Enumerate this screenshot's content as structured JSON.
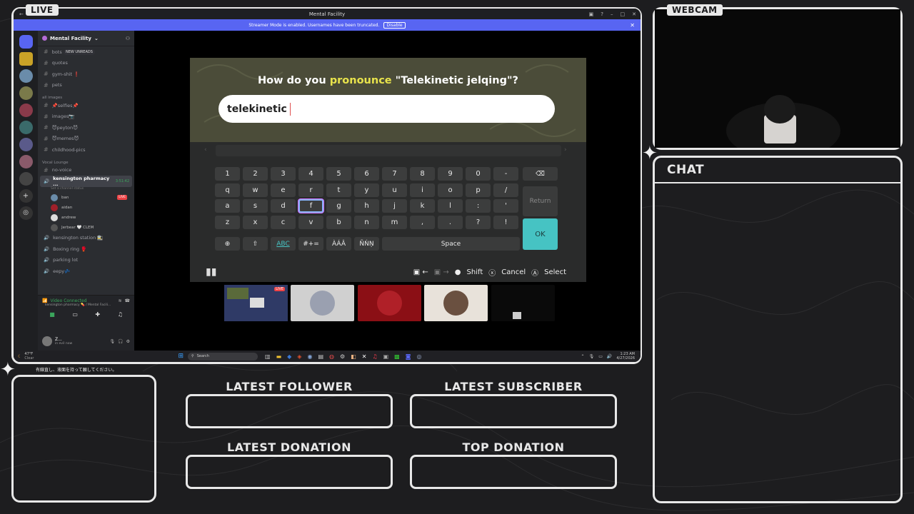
{
  "overlay": {
    "live_tag": "LIVE",
    "webcam_tag": "WEBCAM",
    "chat_title": "CHAT",
    "japanese_note": "有線直し、液面を持って願してください。",
    "latest_follower": "LATEST FOLLOWER",
    "latest_subscriber": "LATEST SUBSCRIBER",
    "latest_donation": "LATEST DONATION",
    "top_donation": "TOP DONATION"
  },
  "discord": {
    "window_title": "Mental Facility",
    "streamer_banner": "Streamer Mode is enabled. Usernames have been truncated.",
    "disable_button": "Disable",
    "server_name": "Mental Facility",
    "new_unreads": "NEW UNREADS",
    "channels_top": [
      {
        "name": "bots"
      },
      {
        "name": "quotes"
      },
      {
        "name": "gym-shit ❗"
      },
      {
        "name": "pets"
      }
    ],
    "category_images": "all images",
    "channels_images": [
      {
        "name": "📌selfies📌"
      },
      {
        "name": "images📷"
      },
      {
        "name": "😈peyton😈"
      },
      {
        "name": "😈memes😈"
      },
      {
        "name": "childhood-pics"
      }
    ],
    "category_voice": "Vocal Lounge",
    "no_voice": "no-voice",
    "active_voice": "kensington pharmacy ...",
    "active_voice_time": "3:51:42",
    "channel_status": "Set a channel status",
    "voice_users": [
      {
        "name": "ban",
        "live": "LIVE"
      },
      {
        "name": "aidan"
      },
      {
        "name": "andrew"
      },
      {
        "name": "Jerbear 🤍 CLEM"
      }
    ],
    "voice_channels": [
      {
        "name": "kensington station 🚉"
      },
      {
        "name": "Boxing ring 🥊"
      },
      {
        "name": "parking lot"
      },
      {
        "name": "eepy💤"
      }
    ],
    "video_connected": "Video Connected",
    "video_location": "kensington pharmacy 💊 / Mental Facili...",
    "user_name": "Z...",
    "user_status": "in evil now",
    "weather_temp": "47°F",
    "weather_desc": "Clear",
    "search_placeholder": "Search",
    "clock_time": "1:23 AM",
    "clock_date": "4/27/2026"
  },
  "game": {
    "question_prefix": "How do you ",
    "question_highlight": "pronounce",
    "question_suffix": " \"Telekinetic jelqing\"?",
    "input_value": "telekinetic",
    "row1": [
      "1",
      "2",
      "3",
      "4",
      "5",
      "6",
      "7",
      "8",
      "9",
      "0",
      "-"
    ],
    "row2": [
      "q",
      "w",
      "e",
      "r",
      "t",
      "y",
      "u",
      "i",
      "o",
      "p",
      "/"
    ],
    "row3": [
      "a",
      "s",
      "d",
      "f",
      "g",
      "h",
      "j",
      "k",
      "l",
      ":",
      "'"
    ],
    "row4": [
      "z",
      "x",
      "c",
      "v",
      "b",
      "n",
      "m",
      ",",
      ".",
      "?",
      "!"
    ],
    "return_label": "Return",
    "ok_label": "OK",
    "mode_abc": "ABC",
    "mode_sym": "#+=",
    "mode_accent1": "ÀÁÂ",
    "mode_accent2": "ÑŃŅ",
    "space_label": "Space",
    "shift_label": "Shift",
    "cancel_label": "Cancel",
    "select_label": "Select"
  },
  "colors": {
    "accent_blurple": "#5865f2",
    "ok_teal": "#46c3c3",
    "highlight_yellow": "#e8e34c",
    "live_red": "#ed4245"
  }
}
